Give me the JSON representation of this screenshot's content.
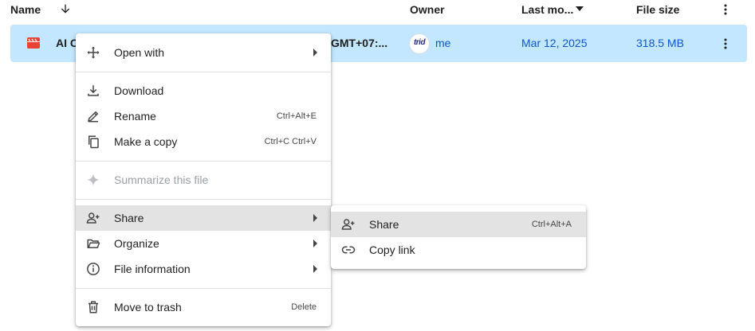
{
  "header": {
    "name_label": "Name",
    "owner_label": "Owner",
    "last_modified_label": "Last mo...",
    "file_size_label": "File size",
    "sort_icon": "arrow-down-icon",
    "more_icon": "more-vert-icon"
  },
  "file_row": {
    "name": "AI C",
    "modified_fragment": "GMT+07:...",
    "owner_avatar_text": "trid",
    "owner": "me",
    "last_modified": "Mar 12, 2025",
    "file_size": "318.5 MB",
    "file_icon": "video-file-icon",
    "icon_color": "#ea4335"
  },
  "context_menu": {
    "open_with": "Open with",
    "download": "Download",
    "rename": "Rename",
    "rename_shortcut": "Ctrl+Alt+E",
    "make_copy": "Make a copy",
    "make_copy_shortcut": "Ctrl+C Ctrl+V",
    "summarize": "Summarize this file",
    "share": "Share",
    "organize": "Organize",
    "file_information": "File information",
    "move_to_trash": "Move to trash",
    "trash_shortcut": "Delete"
  },
  "share_submenu": {
    "share": "Share",
    "share_shortcut": "Ctrl+Alt+A",
    "copy_link": "Copy link"
  },
  "colors": {
    "selected_row": "#c2e7ff",
    "highlight": "#e3e3e3",
    "text": "#1f1f1f",
    "icon": "#444746"
  }
}
